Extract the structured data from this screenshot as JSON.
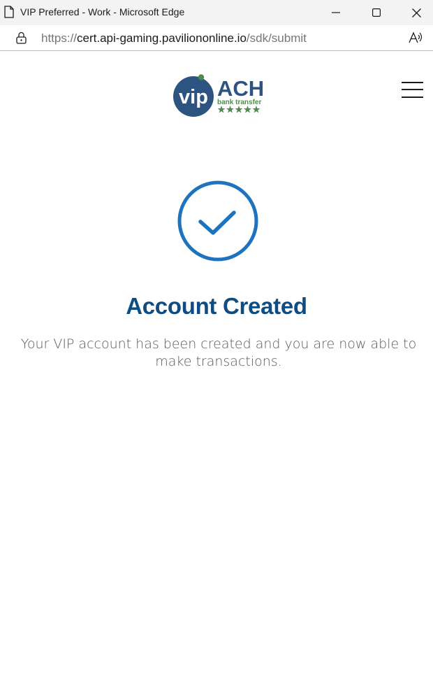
{
  "window": {
    "title": "VIP Preferred - Work - Microsoft Edge"
  },
  "address_bar": {
    "scheme": "https://",
    "host": "cert.api-gaming.pavilion online.io",
    "host_display": "cert.api-gaming.paviliononline.io",
    "path": "/sdk/submit"
  },
  "brand": {
    "logo_mark": "vip",
    "logo_word": "ACH",
    "logo_tagline": "bank transfer",
    "colors": {
      "navy": "#2d5480",
      "green": "#4f8a4f"
    }
  },
  "status": {
    "icon": "check-circle-icon",
    "heading": "Account Created",
    "message": "Your VIP account has been created and you are now able to make transactions.",
    "accent": "#1e73be"
  }
}
